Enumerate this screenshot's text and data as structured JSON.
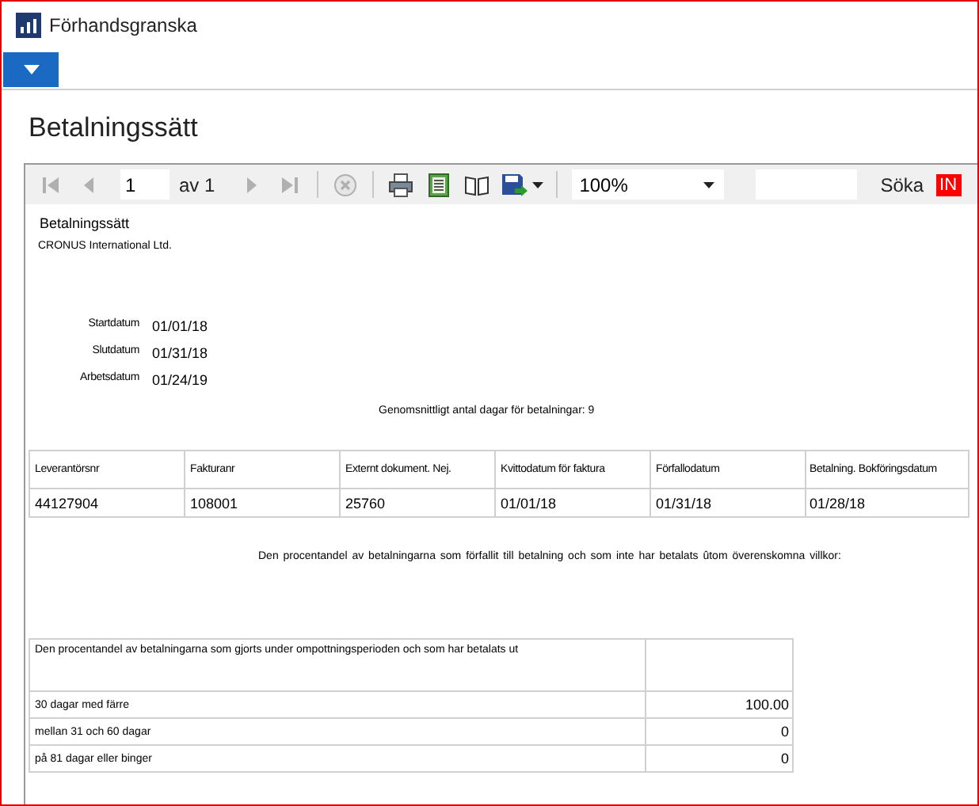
{
  "window": {
    "title": "Förhandsgranska"
  },
  "menu_button": {
    "expanded": false
  },
  "page_title": "Betalningssätt",
  "toolbar": {
    "items": [
      {
        "kind": "first",
        "disabled": true
      },
      {
        "kind": "prev",
        "disabled": true
      },
      {
        "kind": "page",
        "value": "1"
      },
      {
        "kind": "text",
        "label": "av 1"
      },
      {
        "kind": "next",
        "disabled": true
      },
      {
        "kind": "last",
        "disabled": true
      },
      {
        "kind": "sep"
      },
      {
        "kind": "stop",
        "disabled": true
      },
      {
        "kind": "sep"
      },
      {
        "kind": "print"
      },
      {
        "kind": "setup"
      },
      {
        "kind": "layout"
      },
      {
        "kind": "export"
      },
      {
        "kind": "sep"
      },
      {
        "kind": "zoom",
        "value": "100%"
      },
      {
        "kind": "search"
      },
      {
        "kind": "text",
        "label": "Söka"
      },
      {
        "kind": "find",
        "label": "IN"
      }
    ]
  },
  "report": {
    "title": "Betalningssätt",
    "company": "CRONUS International Ltd.",
    "dates": [
      {
        "label": "Startdatum",
        "value": "01/01/18"
      },
      {
        "label": "Slutdatum",
        "value": "01/31/18"
      },
      {
        "label": "Arbetsdatum",
        "value": "01/24/19"
      }
    ],
    "average": "Genomsnittligt antal dagar för betalningar: 9",
    "table": {
      "columns": [
        "Leverantörsnr",
        "Fakturanr",
        "Externt dokument. Nej.",
        "Kvittodatum för faktura",
        "Förfallodatum",
        "Betalning. Bokföringsdatum"
      ],
      "rows": [
        [
          "44127904",
          "108001",
          "25760",
          "01/01/18",
          "01/31/18",
          "01/28/18"
        ]
      ]
    },
    "overdue_note": "Den procentandel av betalningarna som förfallit till betalning och som inte har betalats ûtom överenskomna villkor:",
    "summary": {
      "heading": "Den procentandel av betalningarna som gjorts under ompottningsperioden och som har betalats ut",
      "rows": [
        {
          "label": "30 dagar med färre",
          "value": "100.00"
        },
        {
          "label": "mellan 31 och 60 dagar",
          "value": "0"
        },
        {
          "label": "på 81 dagar eller binger",
          "value": "0"
        }
      ]
    }
  }
}
